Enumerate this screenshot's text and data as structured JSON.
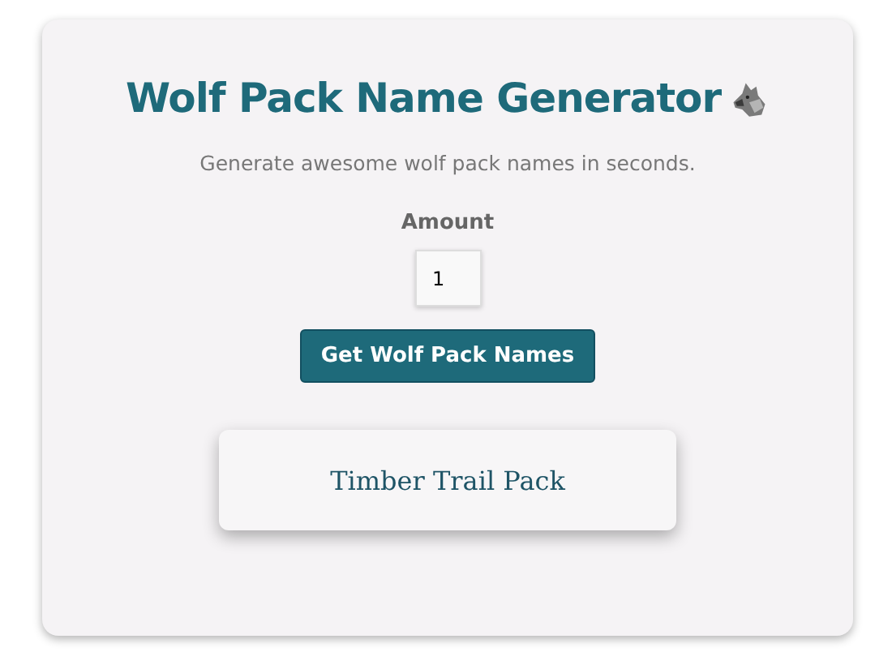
{
  "title": "Wolf Pack Name Generator",
  "subtitle": "Generate awesome wolf pack names in seconds.",
  "amount": {
    "label": "Amount",
    "value": "1"
  },
  "button": "Get Wolf Pack Names",
  "results": [
    "Timber Trail Pack"
  ]
}
